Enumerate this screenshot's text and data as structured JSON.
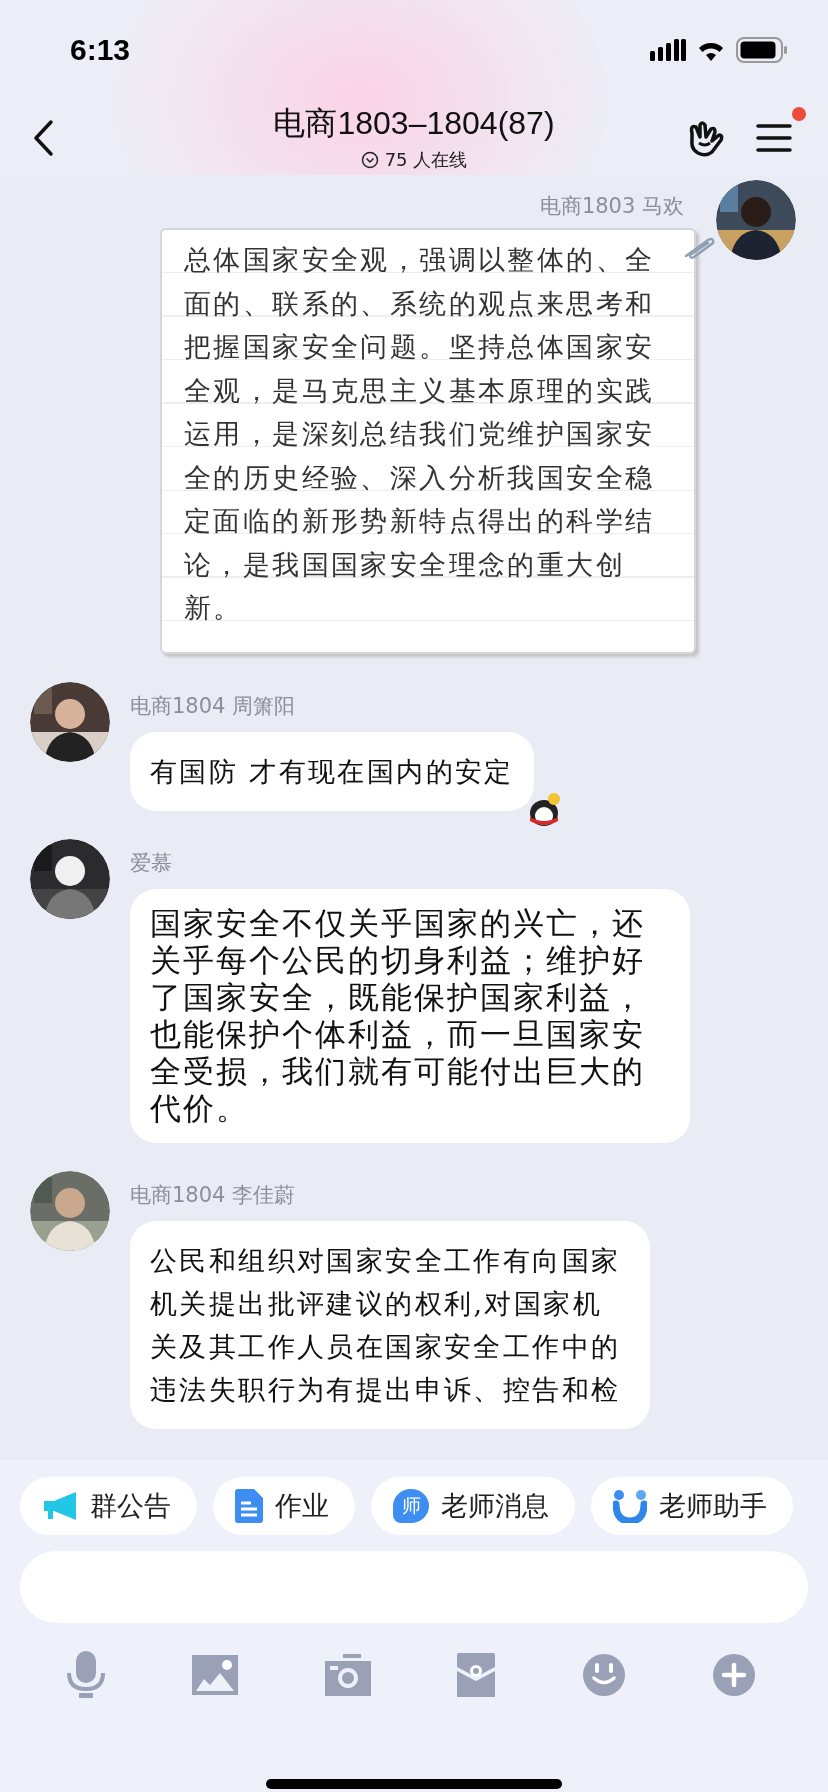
{
  "status_bar": {
    "time": "6:13"
  },
  "header": {
    "title": "电商1803–1804(87)",
    "online": "75 人在线",
    "menu_badge": true
  },
  "messages": [
    {
      "sender": "电商1803 马欢",
      "outgoing": true,
      "kind": "note",
      "sticker": false,
      "text": "总体国家安全观，强调以整体的、全面的、联系的、系统的观点来思考和把握国家安全问题。坚持总体国家安全观，是马克思主义基本原理的实践运用，是深刻总结我们党维护国家安全的历史经验、深入分析我国安全稳定面临的新形势新特点得出的科学结论，是我国国家安全理念的重大创新。"
    },
    {
      "sender": "电商1804 周箫阳",
      "outgoing": false,
      "kind": "script",
      "sticker": true,
      "text": "有国防 才有现在国内的安定"
    },
    {
      "sender": "爱慕",
      "outgoing": false,
      "kind": "plain",
      "sticker": false,
      "text": "国家安全不仅关乎国家的兴亡，还关乎每个公民的切身利益；维护好了国家安全，既能保护国家利益，也能保护个体利益，而一旦国家安全受损，我们就有可能付出巨大的代价。"
    },
    {
      "sender": "电商1804 李佳蔚",
      "outgoing": false,
      "kind": "script",
      "sticker": false,
      "text": "公民和组织对国家安全工作有向国家机关提出批评建议的权利,对国家机关及其工作人员在国家安全工作中的违法失职行为有提出申诉、控告和检"
    }
  ],
  "quick_actions": [
    {
      "kind": "megaphone",
      "label": "群公告"
    },
    {
      "kind": "document",
      "label": "作业"
    },
    {
      "kind": "teacher",
      "label": "老师消息",
      "icon_text": "师"
    },
    {
      "kind": "assistant",
      "label": "老师助手"
    }
  ]
}
